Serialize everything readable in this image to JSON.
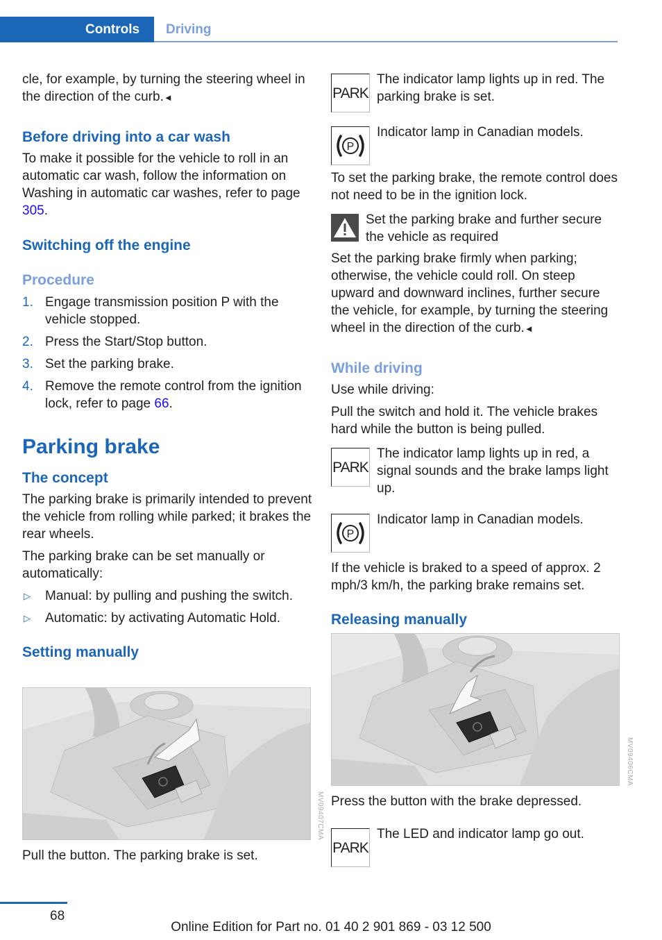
{
  "header": {
    "section": "Controls",
    "subsection": "Driving"
  },
  "left": {
    "intro_text": "cle, for example, by turning the steering wheel in the direction of the curb.",
    "end_mark": "◄",
    "car_wash": {
      "heading": "Before driving into a car wash",
      "text_before": "To make it possible for the vehicle to roll in an automatic car wash, follow the information on Washing in automatic car washes, refer to page ",
      "link": "305",
      "text_after": "."
    },
    "engine_off": {
      "heading": "Switching off the engine",
      "procedure_heading": "Procedure",
      "steps": [
        {
          "num": "1.",
          "text": "Engage transmission position P with the vehicle stopped."
        },
        {
          "num": "2.",
          "text": "Press the Start/Stop button."
        },
        {
          "num": "3.",
          "text": "Set the parking brake."
        },
        {
          "num": "4.",
          "text": "Remove the remote control from the ignition lock, refer to page ",
          "link": "66",
          "after": "."
        }
      ]
    },
    "parking_brake": {
      "title": "Parking brake",
      "concept_heading": "The concept",
      "concept_p1": "The parking brake is primarily intended to prevent the vehicle from rolling while parked; it brakes the rear wheels.",
      "concept_p2": "The parking brake can be set manually or automatically:",
      "bullets": [
        {
          "marker": "▷",
          "text": "Manual: by pulling and pushing the switch."
        },
        {
          "marker": "▷",
          "text": "Automatic: by activating Automatic Hold."
        }
      ],
      "setting_heading": "Setting manually",
      "figure_code": "MV09407CMA",
      "figure_caption": "Pull the button. The parking brake is set."
    }
  },
  "right": {
    "park_lamp_1": {
      "icon_label": "PARK",
      "text": "The indicator lamp lights up in red. The parking brake is set."
    },
    "canada_lamp_1": {
      "text": "Indicator lamp in Canadian models."
    },
    "remote_text": "To set the parking brake, the remote control does not need to be in the ignition lock.",
    "warning": {
      "title": "Set the parking brake and further secure the vehicle as required",
      "text": "Set the parking brake firmly when parking; otherwise, the vehicle could roll. On steep upward and downward inclines, further secure the vehicle, for example, by turning the steering wheel in the direction of the curb.",
      "end_mark": "◄"
    },
    "while_driving": {
      "heading": "While driving",
      "p1": "Use while driving:",
      "p2": "Pull the switch and hold it. The vehicle brakes hard while the button is being pulled."
    },
    "park_lamp_2": {
      "icon_label": "PARK",
      "text": "The indicator lamp lights up in red, a signal sounds and the brake lamps light up."
    },
    "canada_lamp_2": {
      "text": "Indicator lamp in Canadian models."
    },
    "speed_text": "If the vehicle is braked to a speed of approx. 2 mph/3 km/h, the parking brake remains set.",
    "releasing": {
      "heading": "Releasing manually",
      "figure_code": "MV09406CMA",
      "caption": "Press the button with the brake depressed."
    },
    "park_lamp_3": {
      "icon_label": "PARK",
      "text": "The LED and indicator lamp go out."
    }
  },
  "footer": {
    "page_number": "68",
    "edition": "Online Edition for Part no. 01 40 2 901 869 - 03 12 500"
  }
}
